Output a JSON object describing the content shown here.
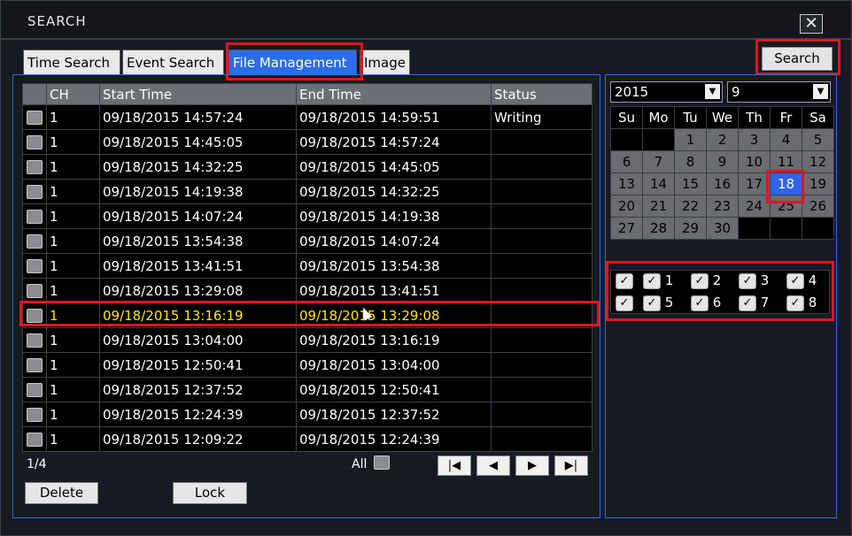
{
  "window": {
    "title": "SEARCH",
    "close_icon": "close-icon"
  },
  "tabs": [
    {
      "label": "Time Search",
      "active": false
    },
    {
      "label": "Event Search",
      "active": false
    },
    {
      "label": "File Management",
      "active": true
    },
    {
      "label": "Image",
      "active": false
    }
  ],
  "search_button": "Search",
  "table": {
    "columns": [
      "",
      "CH",
      "Start Time",
      "End Time",
      "Status"
    ],
    "rows": [
      {
        "ch": "1",
        "start": "09/18/2015 14:57:24",
        "end": "09/18/2015 14:59:51",
        "status": "Writing"
      },
      {
        "ch": "1",
        "start": "09/18/2015 14:45:05",
        "end": "09/18/2015 14:57:24",
        "status": ""
      },
      {
        "ch": "1",
        "start": "09/18/2015 14:32:25",
        "end": "09/18/2015 14:45:05",
        "status": ""
      },
      {
        "ch": "1",
        "start": "09/18/2015 14:19:38",
        "end": "09/18/2015 14:32:25",
        "status": ""
      },
      {
        "ch": "1",
        "start": "09/18/2015 14:07:24",
        "end": "09/18/2015 14:19:38",
        "status": ""
      },
      {
        "ch": "1",
        "start": "09/18/2015 13:54:38",
        "end": "09/18/2015 14:07:24",
        "status": ""
      },
      {
        "ch": "1",
        "start": "09/18/2015 13:41:51",
        "end": "09/18/2015 13:54:38",
        "status": ""
      },
      {
        "ch": "1",
        "start": "09/18/2015 13:29:08",
        "end": "09/18/2015 13:41:51",
        "status": ""
      },
      {
        "ch": "1",
        "start": "09/18/2015 13:16:19",
        "end": "09/18/2015 13:29:08",
        "status": "",
        "selected": true
      },
      {
        "ch": "1",
        "start": "09/18/2015 13:04:00",
        "end": "09/18/2015 13:16:19",
        "status": ""
      },
      {
        "ch": "1",
        "start": "09/18/2015 12:50:41",
        "end": "09/18/2015 13:04:00",
        "status": ""
      },
      {
        "ch": "1",
        "start": "09/18/2015 12:37:52",
        "end": "09/18/2015 12:50:41",
        "status": ""
      },
      {
        "ch": "1",
        "start": "09/18/2015 12:24:39",
        "end": "09/18/2015 12:37:52",
        "status": ""
      },
      {
        "ch": "1",
        "start": "09/18/2015 12:09:22",
        "end": "09/18/2015 12:24:39",
        "status": ""
      }
    ]
  },
  "pagination": {
    "page": "1/4",
    "all_label": "All"
  },
  "nav_icons": [
    "first-page-icon",
    "prev-page-icon",
    "next-page-icon",
    "last-page-icon"
  ],
  "actions": {
    "delete": "Delete",
    "lock": "Lock"
  },
  "calendar": {
    "year": "2015",
    "month": "9",
    "weekdays": [
      "Su",
      "Mo",
      "Tu",
      "We",
      "Th",
      "Fr",
      "Sa"
    ],
    "weeks": [
      [
        "",
        "",
        "1",
        "2",
        "3",
        "4",
        "5"
      ],
      [
        "6",
        "7",
        "8",
        "9",
        "10",
        "11",
        "12"
      ],
      [
        "13",
        "14",
        "15",
        "16",
        "17",
        "18",
        "19"
      ],
      [
        "20",
        "21",
        "22",
        "23",
        "24",
        "25",
        "26"
      ],
      [
        "27",
        "28",
        "29",
        "30",
        "",
        "",
        ""
      ]
    ],
    "selected_day": "18"
  },
  "channels": {
    "row1": [
      "",
      "1",
      "2",
      "3",
      "4"
    ],
    "row2": [
      "",
      "5",
      "6",
      "7",
      "8"
    ],
    "checked": true
  },
  "colors": {
    "accent": "#2b6de8",
    "highlight": "#e2141f",
    "selected_text": "#ffe600",
    "panel_border": "#2f6ed8"
  }
}
